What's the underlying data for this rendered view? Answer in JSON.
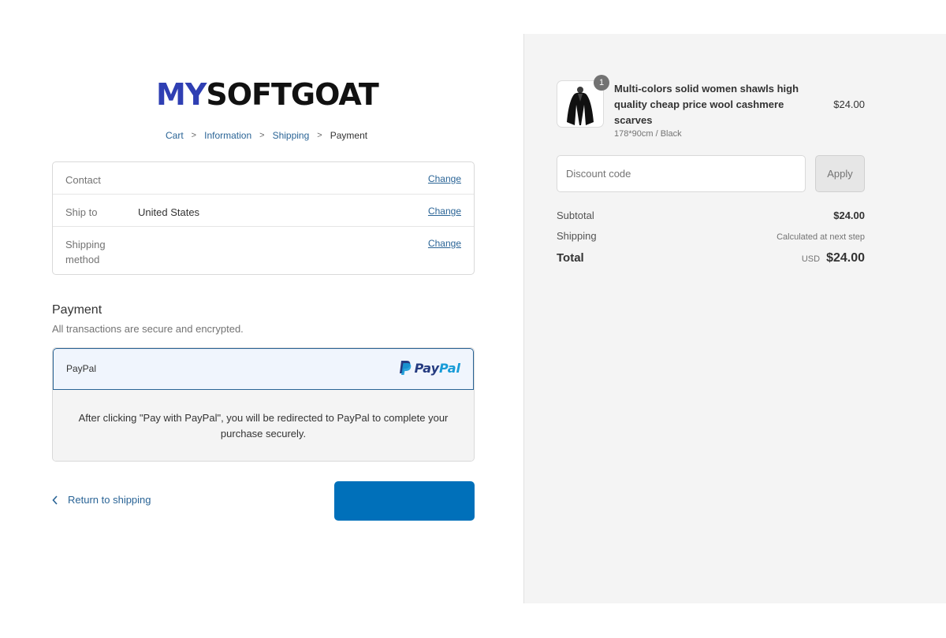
{
  "brand": {
    "logo_part1": "MY",
    "logo_part2": "SOFTGOAT"
  },
  "breadcrumb": {
    "items": [
      "Cart",
      "Information",
      "Shipping",
      "Payment"
    ],
    "separator": ">"
  },
  "review": {
    "contact_label": "Contact",
    "contact_value": "",
    "ship_to_label": "Ship to",
    "ship_to_value": "United States",
    "shipping_method_label": "Shipping method",
    "shipping_method_value": "",
    "change_label": "Change"
  },
  "payment": {
    "title": "Payment",
    "subtitle": "All transactions are secure and encrypted.",
    "option_label": "PayPal",
    "paypal_logo_pay": "Pay",
    "paypal_logo_pal": "Pal",
    "info_text": "After clicking \"Pay with PayPal\", you will be redirected to PayPal to complete your purchase securely."
  },
  "actions": {
    "return_label": "Return to shipping",
    "pay_button_label": ""
  },
  "summary": {
    "product_name": "Multi-colors solid women shawls high quality cheap price wool cashmere scarves",
    "product_variant": "178*90cm / Black",
    "product_price": "$24.00",
    "quantity": "1",
    "discount_placeholder": "Discount code",
    "apply_label": "Apply",
    "subtotal_label": "Subtotal",
    "subtotal_value": "$24.00",
    "shipping_label": "Shipping",
    "shipping_value": "Calculated at next step",
    "total_label": "Total",
    "total_currency": "USD",
    "total_value": "$24.00"
  },
  "colors": {
    "brand_blue": "#2f3fb3",
    "link_blue": "#2a6496",
    "pay_button": "#0070ba",
    "paypal_dark": "#253b80",
    "paypal_light": "#179bd7"
  }
}
